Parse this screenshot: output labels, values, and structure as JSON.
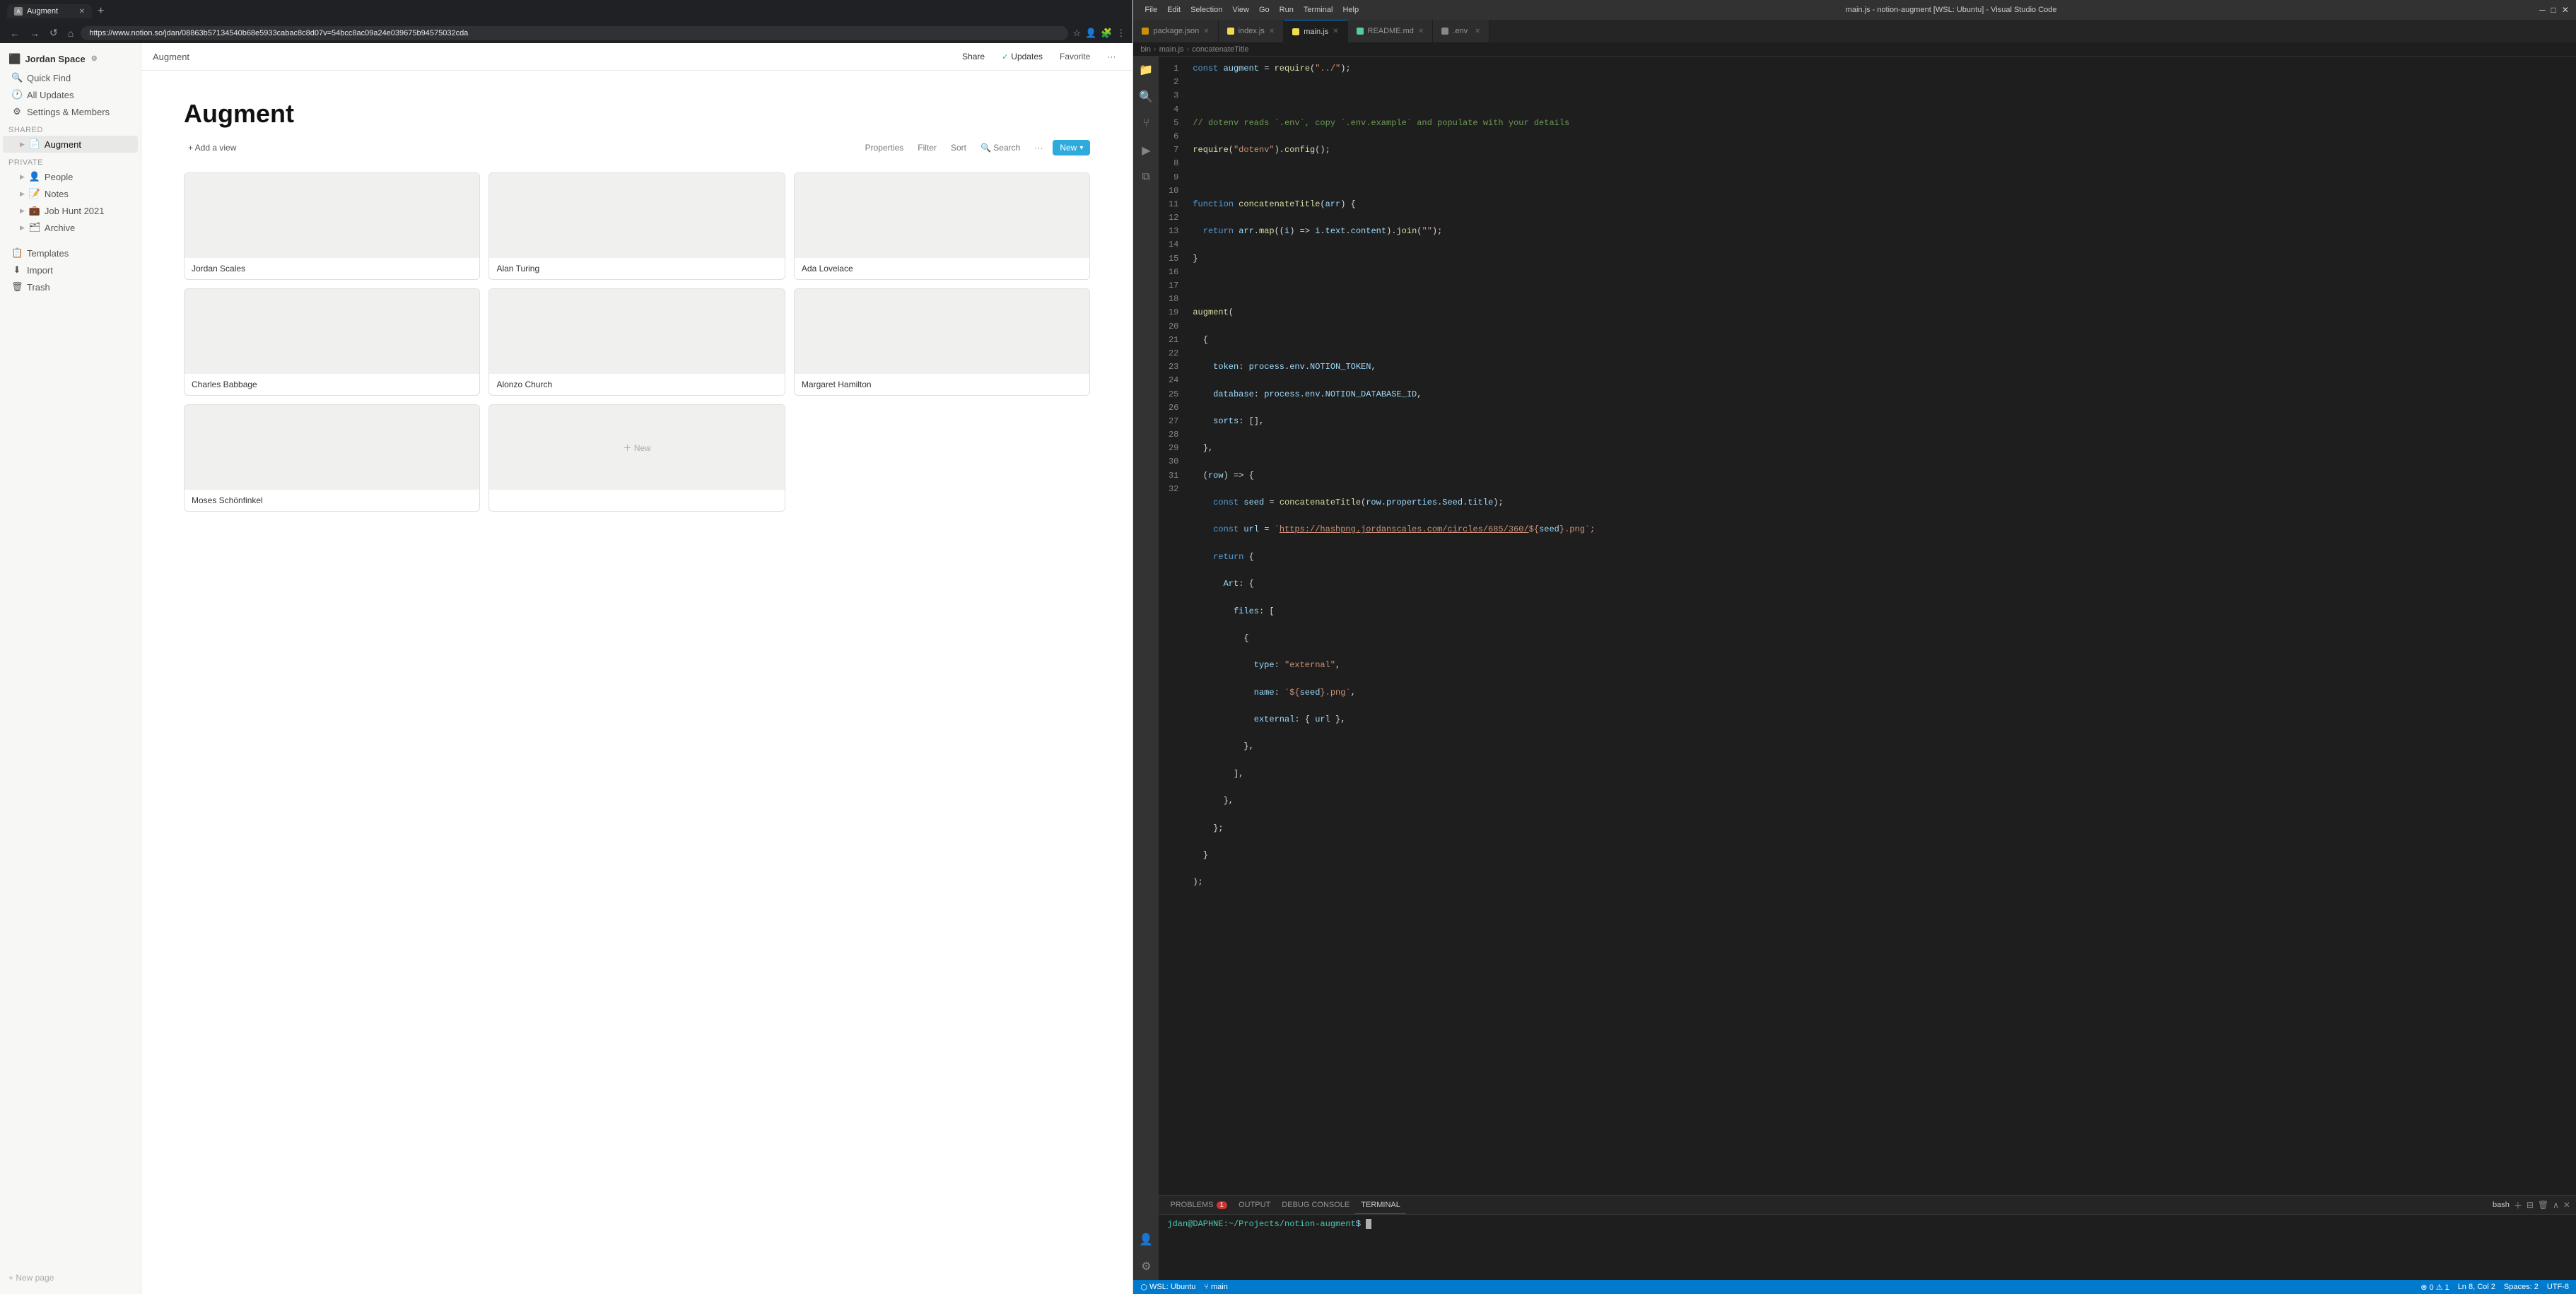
{
  "browser": {
    "tab_title": "Augment",
    "tab_favicon": "A",
    "url": "https://www.notion.so/jdan/08863b57134540b68e5933cabac8c8d07v=54bcc8ac09a24e039675b94575032cda",
    "new_tab_label": "+",
    "nav": {
      "back": "←",
      "forward": "→",
      "refresh": "↺",
      "home": "⌂"
    }
  },
  "notion": {
    "workspace": "Jordan Space",
    "settings_icon": "⚙",
    "quick_find": "Quick Find",
    "all_updates": "All Updates",
    "settings_members": "Settings & Members",
    "sidebar_section_shared": "SHARED",
    "sidebar_section_private": "PRIVATE",
    "shared_items": [
      {
        "icon": "📄",
        "label": "Augment",
        "active": true
      }
    ],
    "private_items": [
      {
        "icon": "👤",
        "label": "People"
      },
      {
        "icon": "📝",
        "label": "Notes"
      },
      {
        "icon": "💼",
        "label": "Job Hunt 2021"
      },
      {
        "icon": "🗂",
        "label": "Archive"
      }
    ],
    "sidebar_bottom": [
      {
        "icon": "📋",
        "label": "Templates"
      },
      {
        "icon": "⬇",
        "label": "Import"
      },
      {
        "icon": "🗑",
        "label": "Trash"
      }
    ],
    "new_page_label": "+ New page",
    "help_icon": "?",
    "topbar": {
      "share": "Share",
      "updates_check": "✓",
      "updates": "Updates",
      "favorite": "Favorite",
      "more": "···"
    },
    "page": {
      "title": "Augment",
      "add_view": "+ Add a view",
      "toolbar": {
        "properties": "Properties",
        "filter": "Filter",
        "sort": "Sort",
        "search": "Search",
        "more": "···",
        "new": "New",
        "new_arrow": "▾"
      },
      "gallery": [
        {
          "name": "Jordan Scales"
        },
        {
          "name": "Alan Turing"
        },
        {
          "name": "Ada Lovelace"
        },
        {
          "name": "Charles Babbage"
        },
        {
          "name": "Alonzo Church"
        },
        {
          "name": "Margaret Hamilton"
        },
        {
          "name": "Moses Schönfinkel"
        },
        {
          "name": "+ New",
          "is_new": true
        }
      ]
    }
  },
  "vscode": {
    "titlebar": {
      "menus": [
        "File",
        "Edit",
        "Selection",
        "View",
        "Go",
        "Run",
        "Terminal",
        "Help"
      ],
      "title": "main.js - notion-augment [WSL: Ubuntu] - Visual Studio Code"
    },
    "tabs": [
      {
        "label": "package.json",
        "type": "json",
        "active": false
      },
      {
        "label": "index.js",
        "type": "js",
        "active": false
      },
      {
        "label": "main.js",
        "type": "js",
        "active": true
      },
      {
        "label": "README.md",
        "type": "md",
        "active": false
      },
      {
        "label": ".env",
        "type": "env",
        "active": false
      }
    ],
    "breadcrumb": [
      "bin",
      "main.js",
      "concatenateTitle"
    ],
    "code_lines": [
      {
        "num": 1,
        "content": "const augment = require(\"../\");"
      },
      {
        "num": 2,
        "content": ""
      },
      {
        "num": 3,
        "content": "// dotenv reads `.env`, copy `.env.example` and populate with your details"
      },
      {
        "num": 4,
        "content": "require(\"dotenv\").config();"
      },
      {
        "num": 5,
        "content": ""
      },
      {
        "num": 6,
        "content": "function concatenateTitle(arr) {"
      },
      {
        "num": 7,
        "content": "  return arr.map((i) => i.text.content).join(\"\");"
      },
      {
        "num": 8,
        "content": "}"
      },
      {
        "num": 9,
        "content": ""
      },
      {
        "num": 10,
        "content": "augment("
      },
      {
        "num": 11,
        "content": "  {"
      },
      {
        "num": 12,
        "content": "    token: process.env.NOTION_TOKEN,"
      },
      {
        "num": 13,
        "content": "    database: process.env.NOTION_DATABASE_ID,"
      },
      {
        "num": 14,
        "content": "    sorts: [],"
      },
      {
        "num": 15,
        "content": "  },"
      },
      {
        "num": 16,
        "content": "  (row) => {"
      },
      {
        "num": 17,
        "content": "    const seed = concatenateTitle(row.properties.Seed.title);"
      },
      {
        "num": 18,
        "content": "    const url = `https://hashpng.jordanscales.com/circles/685/360/${seed}.png`;"
      },
      {
        "num": 19,
        "content": "    return {"
      },
      {
        "num": 20,
        "content": "      Art: {"
      },
      {
        "num": 21,
        "content": "        files: ["
      },
      {
        "num": 22,
        "content": "          {"
      },
      {
        "num": 23,
        "content": "            type: \"external\","
      },
      {
        "num": 24,
        "content": "            name: `${seed}.png`,"
      },
      {
        "num": 25,
        "content": "            external: { url },"
      },
      {
        "num": 26,
        "content": "          },"
      },
      {
        "num": 27,
        "content": "        ],"
      },
      {
        "num": 28,
        "content": "      },"
      },
      {
        "num": 29,
        "content": "    };"
      },
      {
        "num": 30,
        "content": "  }"
      },
      {
        "num": 31,
        "content": ");"
      },
      {
        "num": 32,
        "content": ""
      }
    ],
    "terminal": {
      "tabs": [
        "PROBLEMS",
        "OUTPUT",
        "DEBUG CONSOLE",
        "TERMINAL"
      ],
      "active_tab": "TERMINAL",
      "problems_count": "1",
      "bash_label": "bash",
      "prompt": "jdan@DAPHNE:~/Projects/notion-augment$"
    },
    "statusbar": {
      "wsl": "WSL: Ubuntu",
      "errors": "⊗ 0",
      "warnings": "⚠ 1",
      "line_col": "Ln 8, Col 2",
      "spaces": "Spaces: 2",
      "encoding": "UTF-8",
      "left_items": [
        "⎇ main"
      ]
    }
  }
}
